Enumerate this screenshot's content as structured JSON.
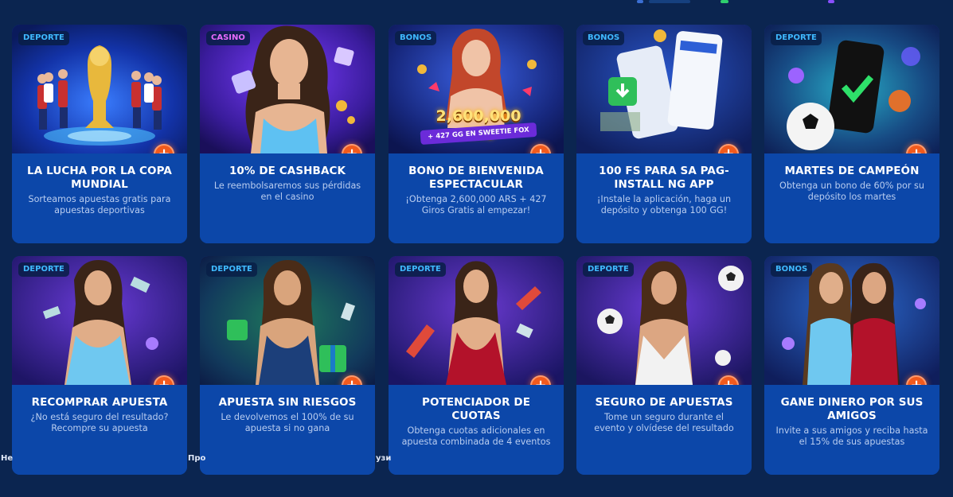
{
  "colors": {
    "page_bg": "#0b2550",
    "card_body": "#0c47a9",
    "tag_deporte": "#3fb9ff",
    "tag_casino": "#e86cff",
    "tag_bonos": "#3fb9ff",
    "accent": "#f25a1d"
  },
  "promotions": [
    {
      "tag": "DEPORTE",
      "title": "LA LUCHA POR LA COPA MUNDIAL",
      "description": "Sorteamos apuestas gratis para apuestas deportivas",
      "image_icon": "world-cup-trophy-icon"
    },
    {
      "tag": "CASINO",
      "title": "10% DE CASHBACK",
      "description": "Le reembolsaremos sus pérdidas en el casino",
      "image_icon": "woman-with-gifts-icon"
    },
    {
      "tag": "BONOS",
      "title": "BONO DE BIENVENIDA ESPECTACULAR",
      "description": "¡Obtenga 2,600,000 ARS + 427 Giros Gratis al empezar!",
      "image_icon": "woman-bonus-banner-icon",
      "banner_amount": "2,600,000 ARS",
      "banner_sub": "+ 427 GG EN SWEETIE FOX"
    },
    {
      "tag": "BONOS",
      "title": "100 FS PARA SA PAG-INSTALL NG APP",
      "description": "¡Instale la aplicación, haga un depósito y obtenga 100 GG!",
      "image_icon": "mobile-app-download-icon"
    },
    {
      "tag": "DEPORTE",
      "title": "MARTES DE CAMPEÓN",
      "description": "Obtenga un bono de 60% por su depósito los martes",
      "image_icon": "phone-checkmark-ball-icon"
    },
    {
      "tag": "DEPORTE",
      "title": "RECOMPRAR APUESTA",
      "description": "¿No está seguro del resultado? Recompre su apuesta",
      "image_icon": "woman-blue-dress-icon"
    },
    {
      "tag": "DEPORTE",
      "title": "APUESTA SIN RIESGOS",
      "description": "Le devolvemos el 100% de su apuesta si no gana",
      "image_icon": "woman-green-gifts-icon"
    },
    {
      "tag": "DEPORTE",
      "title": "POTENCIADOR DE CUOTAS",
      "description": "Obtenga cuotas adicionales en apuesta combinada de 4 eventos",
      "image_icon": "woman-red-dress-rockets-icon"
    },
    {
      "tag": "DEPORTE",
      "title": "SEGURO DE APUESTAS",
      "description": "Tome un seguro durante el evento y olvídese del resultado",
      "image_icon": "woman-soccer-balls-icon"
    },
    {
      "tag": "BONOS",
      "title": "GANE DINERO POR SUS AMIGOS",
      "description": "Invite a sus amigos y reciba hasta el 15% de sus apuestas",
      "image_icon": "two-women-icon"
    }
  ],
  "footer_fragments": [
    "Не",
    "Про",
    "узи"
  ]
}
